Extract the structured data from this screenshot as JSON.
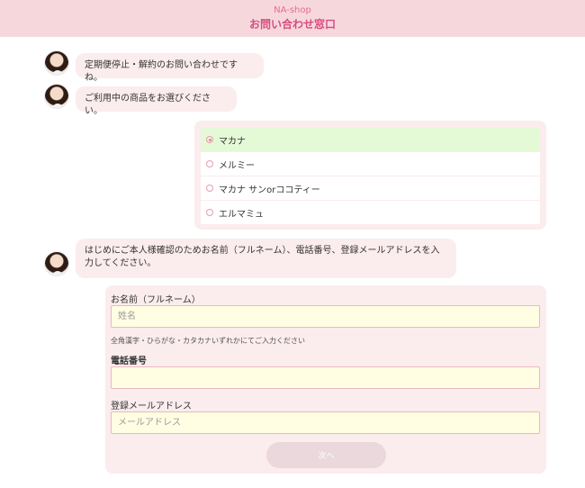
{
  "header": {
    "shop_name": "NA-shop",
    "title": "お問い合わせ窓口"
  },
  "chat": {
    "message_1": "定期便停止・解約のお問い合わせですね。",
    "message_2": "ご利用中の商品をお選びください。",
    "message_3": "はじめにご本人様確認のためお名前（フルネーム）、電話番号、登録メールアドレスを入力してください。"
  },
  "product_options": [
    {
      "label": "マカナ",
      "selected": true
    },
    {
      "label": "メルミー",
      "selected": false
    },
    {
      "label": "マカナ サンorココティー",
      "selected": false
    },
    {
      "label": "エルマミュ",
      "selected": false
    }
  ],
  "form": {
    "name_label": "お名前（フルネーム）",
    "name_placeholder": "姓名",
    "name_hint": "全角漢字・ひらがな・カタカナいずれかにてご入力ください",
    "phone_label": "電話番号",
    "phone_value": "",
    "email_label": "登録メールアドレス",
    "email_placeholder": "メールアドレス",
    "next_button": "次へ"
  },
  "colors": {
    "header_bg": "#f6d8dc",
    "accent_pink": "#d84c82",
    "bubble_bg": "#fbeced",
    "selected_option_bg": "#e4f9d6",
    "input_bg": "#fffee3",
    "input_border": "#ecb9bd",
    "button_disabled_bg": "#ead8dc"
  },
  "icons": {
    "operator_avatar": "operator-avatar",
    "radio": "radio-icon"
  }
}
